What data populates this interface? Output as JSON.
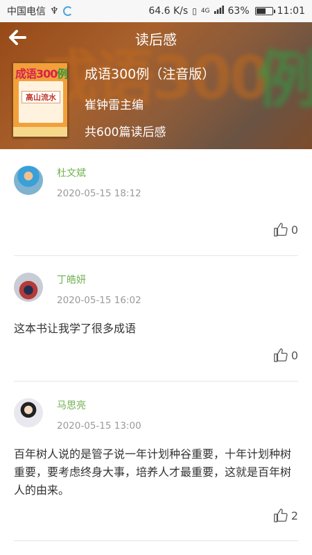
{
  "status_bar": {
    "carrier": "中国电信",
    "usb_symbol": "♆",
    "speed": "64.6 K/s",
    "signal_type": "4G",
    "battery": "63%",
    "battery_level": 0.63,
    "time": "11:01"
  },
  "header": {
    "title": "读后感",
    "back_icon": "arrow-left-icon"
  },
  "book": {
    "title": "成语300例（注音版）",
    "author": "崔钟雷主编",
    "count": "共600篇读后感",
    "cover_title_red": "成语300",
    "cover_title_green": "例",
    "cover_inner_text": "高山流水"
  },
  "comments": [
    {
      "user": "杜文斌",
      "time": "2020-05-15 18:12",
      "text": "",
      "likes": "0"
    },
    {
      "user": "丁皓妍",
      "time": "2020-05-15 16:02",
      "text": "这本书让我学了很多成语",
      "likes": "0"
    },
    {
      "user": "马思亮",
      "time": "2020-05-15 13:00",
      "text": "百年树人说的是管子说一年计划种谷重要，十年计划种树重要，要考虑终身大事，培养人才最重要，这就是百年树人的由来。",
      "likes": "2"
    }
  ],
  "colors": {
    "username": "#6fb24f",
    "timestamp": "#9a9a9a",
    "divider": "#e6e6e6"
  }
}
